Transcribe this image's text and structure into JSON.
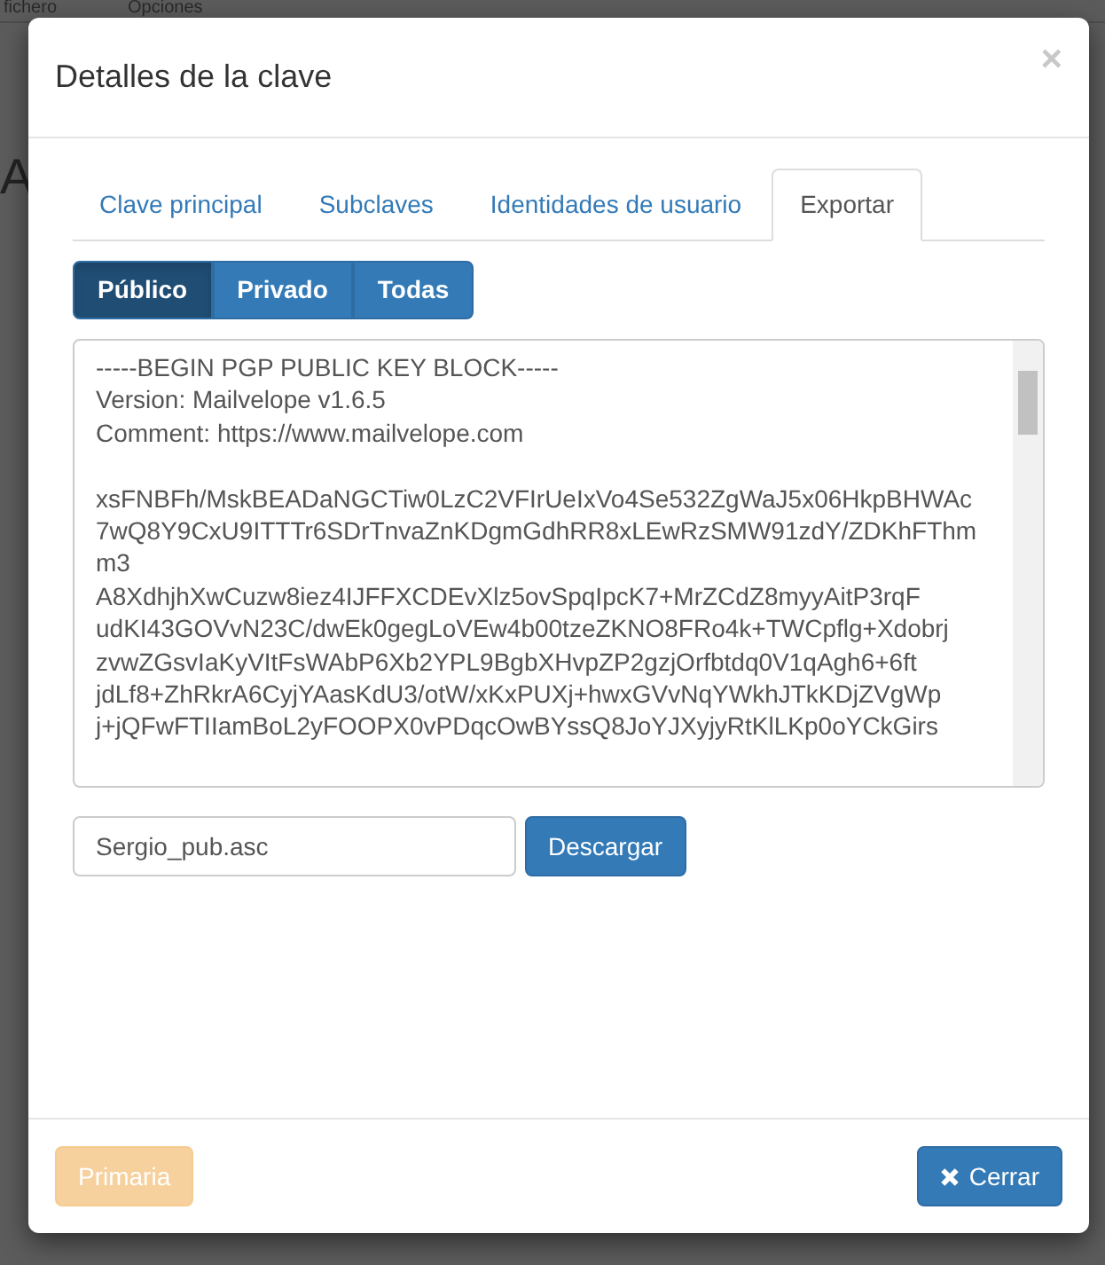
{
  "background": {
    "menu": [
      "fichero",
      "Opciones"
    ],
    "heading": "A"
  },
  "dialog": {
    "title": "Detalles de la clave",
    "close": "×",
    "tabs": [
      {
        "label": "Clave principal",
        "selected": false
      },
      {
        "label": "Subclaves",
        "selected": false
      },
      {
        "label": "Identidades de usuario",
        "selected": false
      },
      {
        "label": "Exportar",
        "selected": true
      }
    ],
    "key_types": [
      {
        "label": "Público",
        "selected": true
      },
      {
        "label": "Privado",
        "selected": false
      },
      {
        "label": "Todas",
        "selected": false
      }
    ],
    "key_header": [
      "-----BEGIN PGP PUBLIC KEY BLOCK-----",
      "Version: Mailvelope v1.6.5",
      "Comment: https://www.mailvelope.com"
    ],
    "key_body": [
      "xsFNBFh/MskBEADaNGCTiw0LzC2VFIrUeIxVo4Se532ZgWaJ5x06HkpBHWAc",
      "7wQ8Y9CxU9ITTTr6SDrTnvaZnKDgmGdhRR8xLEwRzSMW91zdY/ZDKhFThm",
      "m3",
      "A8XdhjhXwCuzw8iez4IJFFXCDEvXlz5ovSpqIpcK7+MrZCdZ8myyAitP3rqF",
      "udKI43GOVvN23C/dwEk0gegLoVEw4b00tzeZKNO8FRo4k+TWCpflg+Xdobrj",
      "zvwZGsvIaKyVItFsWAbP6Xb2YPL9BgbXHvpZP2gzjOrfbtdq0V1qAgh6+6ft",
      "jdLf8+ZhRkrA6CyjYAasKdU3/otW/xKxPUXj+hwxGVvNqYWkhJTkKDjZVgWp",
      "j+jQFwFTIIamBoL2yFOOPX0vPDqcOwBYssQ8JoYJXyjyRtKlLKp0oYCkGirs"
    ],
    "filename": "Sergio_pub.asc",
    "download": "Descargar",
    "footer": [
      {
        "label": "Primaria",
        "kind": "primary",
        "disabled": true
      },
      {
        "label": "Cerrar",
        "kind": "close",
        "disabled": false
      }
    ]
  }
}
